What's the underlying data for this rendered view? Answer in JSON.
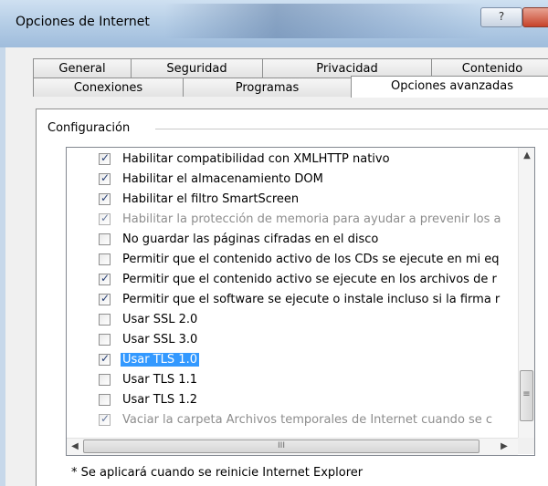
{
  "window": {
    "title": "Opciones de Internet",
    "help_label": "?"
  },
  "tabs": {
    "row1": [
      "General",
      "Seguridad",
      "Privacidad",
      "Contenido"
    ],
    "row2": [
      "Conexiones",
      "Programas",
      "Opciones avanzadas"
    ]
  },
  "group": {
    "label": "Configuración"
  },
  "settings": [
    {
      "label": "Habilitar compatibilidad con XMLHTTP nativo",
      "checked": true
    },
    {
      "label": "Habilitar el almacenamiento DOM",
      "checked": true
    },
    {
      "label": "Habilitar el filtro SmartScreen",
      "checked": true
    },
    {
      "label": "Habilitar la protección de memoria para ayudar a prevenir los a",
      "checked": true,
      "disabled": true
    },
    {
      "label": "No guardar las páginas cifradas en el disco",
      "checked": false
    },
    {
      "label": "Permitir que el contenido activo de los CDs se ejecute en mi eq",
      "checked": false
    },
    {
      "label": "Permitir que el contenido activo se ejecute en los archivos de r",
      "checked": true
    },
    {
      "label": "Permitir que el software se ejecute o instale incluso si la firma r",
      "checked": true
    },
    {
      "label": "Usar SSL 2.0",
      "checked": false
    },
    {
      "label": "Usar SSL 3.0",
      "checked": false
    },
    {
      "label": "Usar TLS 1.0",
      "checked": true,
      "selected": true
    },
    {
      "label": "Usar TLS 1.1",
      "checked": false
    },
    {
      "label": "Usar TLS 1.2",
      "checked": false
    },
    {
      "label": "Vaciar la carpeta Archivos temporales de Internet cuando se c",
      "checked": true,
      "disabled": true
    }
  ],
  "scroll": {
    "up": "▲",
    "down": "▼",
    "left": "◀",
    "right": "▶",
    "thumb_grip": "≡",
    "h_grip": "III"
  },
  "footnote": "* Se aplicará cuando se reinicie Internet Explorer"
}
